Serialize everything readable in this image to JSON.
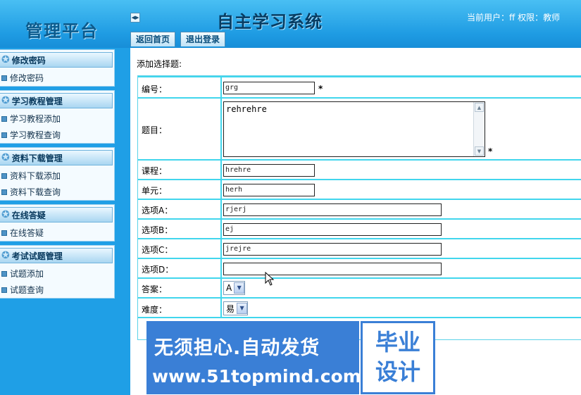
{
  "header": {
    "platform_title": "管理平台",
    "system_title": "自主学习系统",
    "user_info": "当前用户：ff 权限：教师",
    "tabs": [
      "返回首页",
      "退出登录"
    ]
  },
  "sidebar": {
    "groups": [
      {
        "title": "修改密码",
        "items": [
          "修改密码"
        ]
      },
      {
        "title": "学习教程管理",
        "items": [
          "学习教程添加",
          "学习教程查询"
        ]
      },
      {
        "title": "资料下载管理",
        "items": [
          "资料下载添加",
          "资料下载查询"
        ]
      },
      {
        "title": "在线答疑",
        "items": [
          "在线答疑"
        ]
      },
      {
        "title": "考试试题管理",
        "items": [
          "试题添加",
          "试题查询"
        ]
      }
    ]
  },
  "main": {
    "section_title": "添加选择题:",
    "required_mark": "*",
    "fields": {
      "number": {
        "label": "编号：",
        "value": "grg"
      },
      "question": {
        "label": "题目：",
        "value": "rehrehre"
      },
      "course": {
        "label": "课程：",
        "value": "hrehre"
      },
      "unit": {
        "label": "单元：",
        "value": "herh"
      },
      "option_a": {
        "label": "选项A：",
        "value": "rjerj"
      },
      "option_b": {
        "label": "选项B：",
        "value": "ej"
      },
      "option_c": {
        "label": "选项C：",
        "value": "jrejre"
      },
      "option_d": {
        "label": "选项D：",
        "value": ""
      },
      "answer": {
        "label": "答案：",
        "value": "A"
      },
      "difficulty": {
        "label": "难度：",
        "value": "易"
      }
    }
  },
  "watermark": {
    "slogan": "无须担心.自动发货",
    "url": "www.51topmind.com",
    "badge_line1": "毕业",
    "badge_line2": "设计"
  },
  "colors": {
    "header_blue": "#1f9ce3",
    "sidebar_blue": "#1f9fe6",
    "grid_cyan": "#41d6ed",
    "watermark_blue": "#3a7fd6"
  }
}
